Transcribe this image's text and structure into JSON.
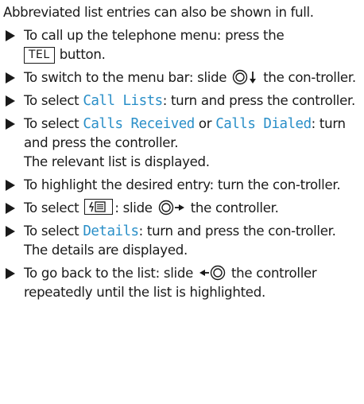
{
  "intro": "Abbreviated list entries can also be shown in full.",
  "steps": [
    {
      "before": "To call up the telephone menu: press the",
      "key": "TEL",
      "after": "button."
    },
    {
      "before": "To switch to the menu bar: slide",
      "after": "the con-troller."
    },
    {
      "before": "To select",
      "term": "Call Lists",
      "after": ": turn and press the controller."
    },
    {
      "before": "To select",
      "term1": "Calls Received",
      "mid": "or",
      "term2": "Calls Dialed",
      "after": ": turn and press the controller.",
      "result": "The relevant list is displayed."
    },
    {
      "text": "To highlight the desired entry: turn the con-troller."
    },
    {
      "before": "To select",
      "mid": ": slide",
      "after": "the controller."
    },
    {
      "before": "To select",
      "term": "Details",
      "after": ": turn and press the con-troller.",
      "result": "The details are displayed."
    },
    {
      "before": "To go back to the list: slide",
      "after": "the controller repeatedly until the list is highlighted."
    }
  ],
  "icons": {
    "bullet": "triangle-right-icon",
    "controller": "controller-icon",
    "phonebook": "phonebook-icon"
  },
  "colors": {
    "text": "#1a1a1a",
    "menu_term": "#2a8fc8"
  }
}
